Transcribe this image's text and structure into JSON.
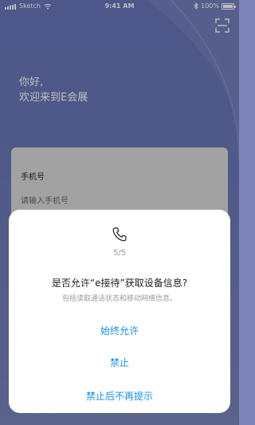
{
  "status_bar": {
    "carrier": "Sketch",
    "time": "9:41 AM",
    "battery": "100%",
    "battery_level": 1.0
  },
  "greeting": {
    "line1": "你好,",
    "line2": "欢迎来到E会展"
  },
  "login": {
    "phone_label": "手机号",
    "phone_placeholder": "请输入手机号"
  },
  "dialog": {
    "count": "5/5",
    "title": "是否允许“e接待”获取设备信息?",
    "subtitle": "包括读取通话状态和移动网络信息。",
    "allow_always": "始终允许",
    "deny": "禁止",
    "deny_never_ask": "禁止后不再提示",
    "accent_color": "#1a8fe0"
  }
}
